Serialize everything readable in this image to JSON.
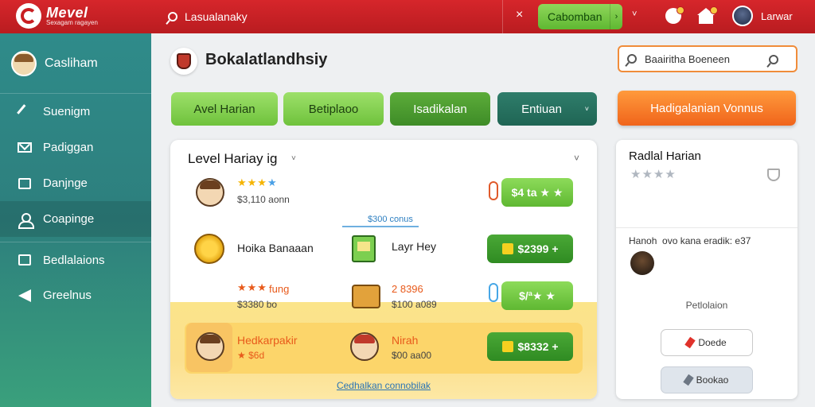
{
  "topbar": {
    "logo_title": "Mevel",
    "logo_sub": "Sexagam ragayen",
    "search_text": "Lasualanaky",
    "close_glyph": "×",
    "cta_label": "Cabomban",
    "cta_arrow": "›",
    "caret": "˅",
    "user_name": "Larwar",
    "colors": {
      "bar": "#c8232a",
      "cta": "#6fc23c"
    }
  },
  "sidebar": {
    "title": "Casliham",
    "items": [
      {
        "label": "Suenigm",
        "icon": "microphone-icon"
      },
      {
        "label": "Padiggan",
        "icon": "mail-icon"
      },
      {
        "label": "Danjnge",
        "icon": "square-icon"
      },
      {
        "label": "Coapinge",
        "icon": "user-icon"
      },
      {
        "label": "Bedlalaions",
        "icon": "panel-icon"
      },
      {
        "label": "Greelnus",
        "icon": "send-icon"
      }
    ],
    "colors": {
      "bg": "#2f8b8a"
    }
  },
  "main": {
    "title": "Bokalatlandhsiy",
    "search_value": "Baairitha Boeneen",
    "pills": [
      "Avel Harian",
      "Betiplaoo",
      "Isadikalan",
      "Entiuan"
    ],
    "pill_caret": "˅",
    "bonus_label": "Hadigalanian Vonnus",
    "card": {
      "title": "Level Hariay ig",
      "caret": "˅",
      "rows": [
        {
          "stars": "★★★",
          "sub": "$3,110 aonn",
          "price": "$4 ta ★ ★"
        },
        {
          "name": "Hoika Banaaan",
          "mid_name": "Layr Hey",
          "price": "$2399 +"
        },
        {
          "stars": "★★★",
          "name": "fung",
          "sub": "$3380 bo",
          "mid_name": "2 8396",
          "mid_sub": "$100 a089",
          "price": "$/ª★ ★"
        },
        {
          "name": "Hedkarpakir",
          "sub": "★ $6d",
          "mid_name": "Nirah",
          "mid_sub": "$00 aa00",
          "price": "$8332 +"
        }
      ],
      "divider_label": "$300 conus",
      "footer_link": "Cedhalkan connobilak"
    }
  },
  "right_panel": {
    "title": "Radlal Harian",
    "stars": "★★★★",
    "text": "Hanoh  ovo kana eradik: e37",
    "label": "Petlolaion",
    "button_a": "Doede",
    "button_b": "Bookao"
  }
}
